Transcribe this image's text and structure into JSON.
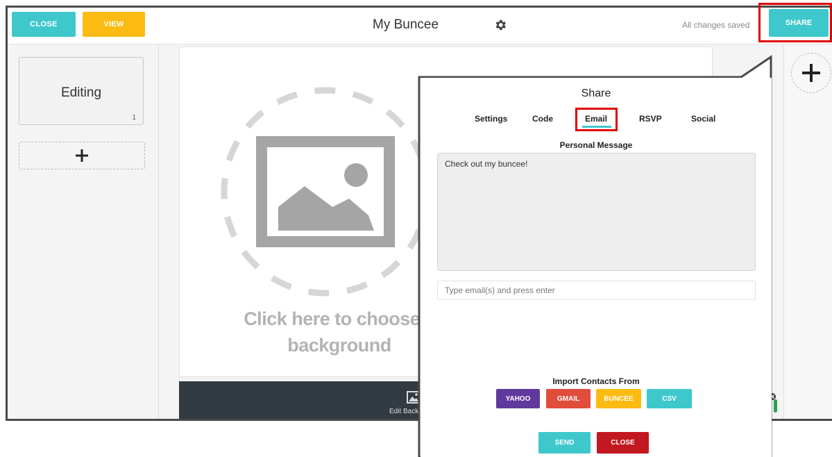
{
  "toolbar": {
    "close_label": "CLOSE",
    "view_label": "VIEW",
    "title": "My Buncee",
    "status": "All changes saved",
    "share_label": "SHARE"
  },
  "slides": {
    "items": [
      {
        "label": "Editing",
        "number": "1"
      }
    ]
  },
  "canvas": {
    "background_prompt_line1": "Click here to choose a",
    "background_prompt_line2": "background",
    "edit_background_label": "Edit Background"
  },
  "share_modal": {
    "title": "Share",
    "tabs": [
      {
        "label": "Settings"
      },
      {
        "label": "Code"
      },
      {
        "label": "Email",
        "active": true
      },
      {
        "label": "RSVP"
      },
      {
        "label": "Social"
      }
    ],
    "personal_message_label": "Personal Message",
    "personal_message_value": "Check out my buncee!",
    "email_placeholder": "Type email(s) and press enter",
    "import_label": "Import Contacts From",
    "import_buttons": {
      "yahoo": "YAHOO",
      "gmail": "GMAIL",
      "buncee": "BUNCEE",
      "csv": "CSV"
    },
    "send_label": "SEND",
    "close_label": "CLOSE"
  },
  "colors": {
    "teal": "#3fc8cc",
    "yellow": "#fcbb12",
    "highlight_red": "#e00000",
    "yahoo_purple": "#61399d",
    "gmail_red": "#e14d3b",
    "close_red": "#c2181f",
    "dark_bar": "#333b42"
  }
}
